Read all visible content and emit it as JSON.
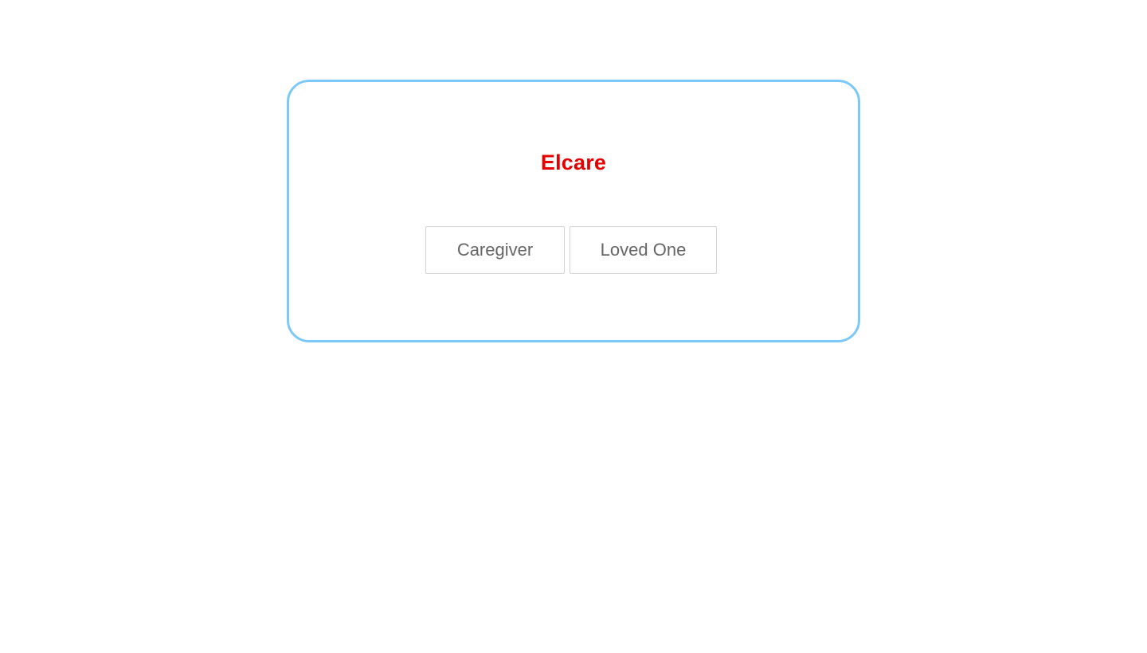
{
  "brand": {
    "name": "Elcare",
    "color": "#e60000"
  },
  "card": {
    "border_color": "#7cc8f8"
  },
  "role_selection": {
    "options": [
      {
        "label": "Caregiver"
      },
      {
        "label": "Loved One"
      }
    ]
  }
}
